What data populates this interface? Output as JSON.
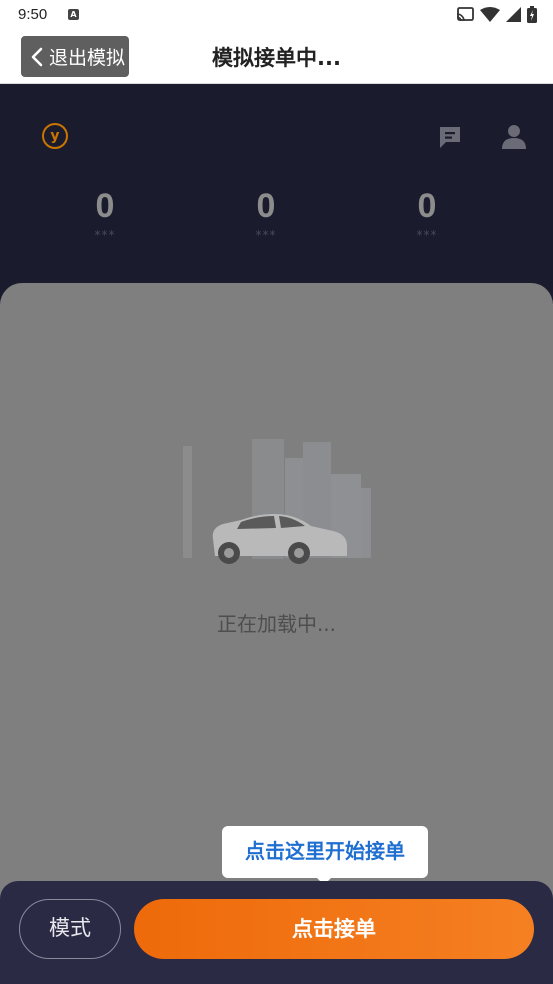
{
  "status_bar": {
    "time": "9:50",
    "notification_icon": "a-icon",
    "icons": [
      "cast-icon",
      "wifi-icon",
      "signal-icon",
      "battery-icon"
    ]
  },
  "navbar": {
    "back_label": "退出模拟",
    "title": "模拟接单中..."
  },
  "header": {
    "logo_icon": "logo-icon",
    "logo_text": "y",
    "icons": [
      "message-icon",
      "user-icon"
    ]
  },
  "stats": [
    {
      "value": "0",
      "label": "***"
    },
    {
      "value": "0",
      "label": "***"
    },
    {
      "value": "0",
      "label": "***"
    }
  ],
  "main": {
    "illustration_icon": "car-city-illustration",
    "loading_text": "正在加载中..."
  },
  "tooltip": {
    "text": "点击这里开始接单"
  },
  "bottom_bar": {
    "mode_label": "模式",
    "accept_label": "点击接单"
  },
  "colors": {
    "accent_orange": "#ef6c0c",
    "tooltip_text": "#1f6fd1",
    "dark_bg": "#1b1b2e",
    "overlay_gray": "#7f7f7f"
  }
}
